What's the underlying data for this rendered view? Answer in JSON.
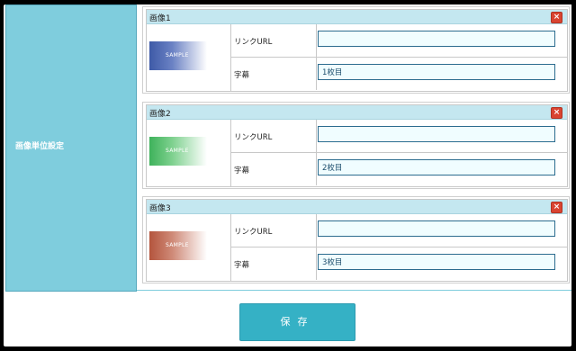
{
  "section_label": "画像単位設定",
  "blocks": [
    {
      "title": "画像1",
      "thumb_text": "SAMPLE",
      "thumb_color": "#3e5aa7",
      "link_label": "リンクURL",
      "link_value": "",
      "caption_label": "字幕",
      "caption_value": "1枚目"
    },
    {
      "title": "画像2",
      "thumb_text": "SAMPLE",
      "thumb_color": "#3eb25b",
      "link_label": "リンクURL",
      "link_value": "",
      "caption_label": "字幕",
      "caption_value": "2枚目"
    },
    {
      "title": "画像3",
      "thumb_text": "SAMPLE",
      "thumb_color": "#b4553d",
      "link_label": "リンクURL",
      "link_value": "",
      "caption_label": "字幕",
      "caption_value": "3枚目"
    }
  ],
  "close_glyph": "×",
  "save_label": "保存",
  "colors": {
    "accent": "#7fcddd",
    "button": "#35b1c5",
    "close": "#d94431"
  }
}
